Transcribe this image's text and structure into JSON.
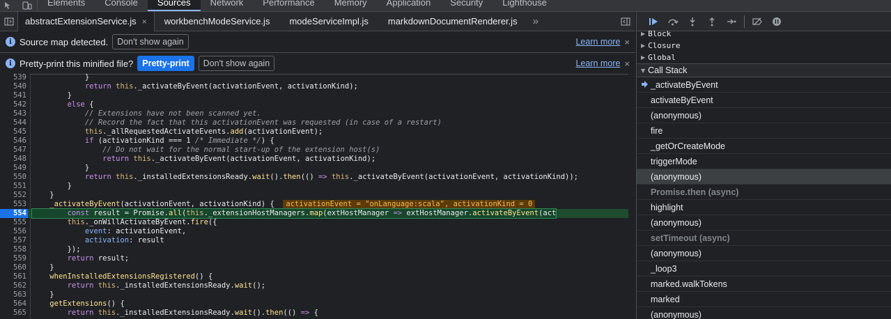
{
  "devtools_tabs": [
    "Elements",
    "Console",
    "Sources",
    "Network",
    "Performance",
    "Memory",
    "Application",
    "Security",
    "Lighthouse"
  ],
  "active_devtools_tab": "Sources",
  "file_tabs": [
    {
      "label": "abstractExtensionService.js",
      "active": true
    },
    {
      "label": "workbenchModeService.js",
      "active": false
    },
    {
      "label": "modeServiceImpl.js",
      "active": false
    },
    {
      "label": "markdownDocumentRenderer.js",
      "active": false
    }
  ],
  "file_tabs_more": "»",
  "infobars": {
    "source_map": {
      "message": "Source map detected.",
      "dismiss": "Don't show again",
      "learn_more": "Learn more",
      "close": "×"
    },
    "pretty_print": {
      "message": "Pretty-print this minified file?",
      "action": "Pretty-print",
      "dismiss": "Don't show again",
      "learn_more": "Learn more",
      "close": "×"
    }
  },
  "code": {
    "current_line": 554,
    "inline_value": "activationEvent = \"onLanguage:scala\", activationKind = 0",
    "lines": [
      {
        "n": "539",
        "t": "            }"
      },
      {
        "n": "540",
        "t": "            return this._activateByEvent(activationEvent, activationKind);"
      },
      {
        "n": "541",
        "t": "        }"
      },
      {
        "n": "542",
        "t": "        else {"
      },
      {
        "n": "543",
        "t": "            // Extensions have not been scanned yet."
      },
      {
        "n": "544",
        "t": "            // Record the fact that this activationEvent was requested (in case of a restart)"
      },
      {
        "n": "545",
        "t": "            this._allRequestedActivateEvents.add(activationEvent);"
      },
      {
        "n": "546",
        "t": "            if (activationKind === 1 /* Immediate */) {"
      },
      {
        "n": "547",
        "t": "                // Do not wait for the normal start-up of the extension host(s)"
      },
      {
        "n": "548",
        "t": "                return this._activateByEvent(activationEvent, activationKind);"
      },
      {
        "n": "549",
        "t": "            }"
      },
      {
        "n": "550",
        "t": "            return this._installedExtensionsReady.wait().then(() => this._activateByEvent(activationEvent, activationKind));"
      },
      {
        "n": "551",
        "t": "        }"
      },
      {
        "n": "552",
        "t": "    }"
      },
      {
        "n": "553",
        "t": "    _activateByEvent(activationEvent, activationKind) {"
      },
      {
        "n": "554",
        "t": "        const result = Promise.all(this._extensionHostManagers.map(extHostManager => extHostManager.activateByEvent(act"
      },
      {
        "n": "555",
        "t": "        this._onWillActivateByEvent.fire({"
      },
      {
        "n": "556",
        "t": "            event: activationEvent,"
      },
      {
        "n": "557",
        "t": "            activation: result"
      },
      {
        "n": "558",
        "t": "        });"
      },
      {
        "n": "559",
        "t": "        return result;"
      },
      {
        "n": "560",
        "t": "    }"
      },
      {
        "n": "561",
        "t": "    whenInstalledExtensionsRegistered() {"
      },
      {
        "n": "562",
        "t": "        return this._installedExtensionsReady.wait();"
      },
      {
        "n": "563",
        "t": "    }"
      },
      {
        "n": "564",
        "t": "    getExtensions() {"
      },
      {
        "n": "565",
        "t": "        return this._installedExtensionsReady.wait().then(() => {"
      }
    ]
  },
  "scope": {
    "items": [
      "Block",
      "Closure",
      "Global"
    ],
    "call_stack_title": "Call Stack"
  },
  "call_stack": [
    {
      "label": "_activateByEvent",
      "current": true,
      "async": false,
      "selected": false
    },
    {
      "label": "activateByEvent",
      "current": false,
      "async": false,
      "selected": false
    },
    {
      "label": "(anonymous)",
      "current": false,
      "async": false,
      "selected": false
    },
    {
      "label": "fire",
      "current": false,
      "async": false,
      "selected": false
    },
    {
      "label": "_getOrCreateMode",
      "current": false,
      "async": false,
      "selected": false
    },
    {
      "label": "triggerMode",
      "current": false,
      "async": false,
      "selected": false
    },
    {
      "label": "(anonymous)",
      "current": false,
      "async": false,
      "selected": true
    },
    {
      "label": "Promise.then (async)",
      "current": false,
      "async": true,
      "selected": false
    },
    {
      "label": "highlight",
      "current": false,
      "async": false,
      "selected": false
    },
    {
      "label": "(anonymous)",
      "current": false,
      "async": false,
      "selected": false
    },
    {
      "label": "setTimeout (async)",
      "current": false,
      "async": true,
      "selected": false
    },
    {
      "label": "(anonymous)",
      "current": false,
      "async": false,
      "selected": false
    },
    {
      "label": "_loop3",
      "current": false,
      "async": false,
      "selected": false
    },
    {
      "label": "marked.walkTokens",
      "current": false,
      "async": false,
      "selected": false
    },
    {
      "label": "marked",
      "current": false,
      "async": false,
      "selected": false
    },
    {
      "label": "(anonymous)",
      "current": false,
      "async": false,
      "selected": false
    }
  ],
  "colors": {
    "accent": "#8ab4f8",
    "exec_line": "#1f4b2e",
    "primary_button": "#1a73e8"
  }
}
